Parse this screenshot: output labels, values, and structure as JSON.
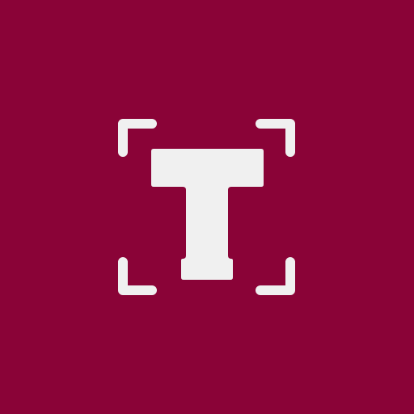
{
  "app": {
    "icon_name": "text-recognition-icon",
    "colors": {
      "background": "#8a0337",
      "glyph": "#f0f0f0"
    }
  },
  "icon": {
    "symbol": "T",
    "frame": "scan-corner-brackets"
  }
}
